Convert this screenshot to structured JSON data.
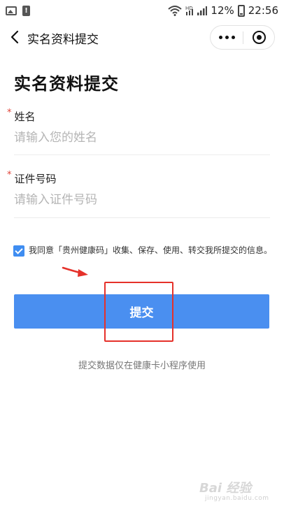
{
  "status_bar": {
    "battery_percent": "12%",
    "time": "22:56",
    "left_icons": [
      "image-icon",
      "alert-icon"
    ],
    "right_icons": [
      "wifi-icon",
      "hd-signal-icon",
      "signal-icon",
      "battery-icon"
    ]
  },
  "nav": {
    "title": "实名资料提交",
    "back_icon": "chevron-left-icon",
    "more_icon": "more-dots-icon",
    "close_icon": "close-circle-icon"
  },
  "page": {
    "title": "实名资料提交"
  },
  "form": {
    "name_field": {
      "required_mark": "*",
      "label": "姓名",
      "placeholder": "请输入您的姓名",
      "value": ""
    },
    "id_field": {
      "required_mark": "*",
      "label": "证件号码",
      "placeholder": "请输入证件号码",
      "value": ""
    },
    "agreement": {
      "checked": true,
      "text": "我同意「贵州健康码」收集、保存、使用、转交我所提交的信息。"
    },
    "submit_label": "提交"
  },
  "footer": {
    "note": "提交数据仅在健康卡小程序使用"
  },
  "colors": {
    "accent": "#4a8ff0",
    "required": "#e0453a",
    "annotation": "#e5312a"
  },
  "watermark": {
    "logo_text": "Bai 经验",
    "url": "jingyan.baidu.com"
  }
}
